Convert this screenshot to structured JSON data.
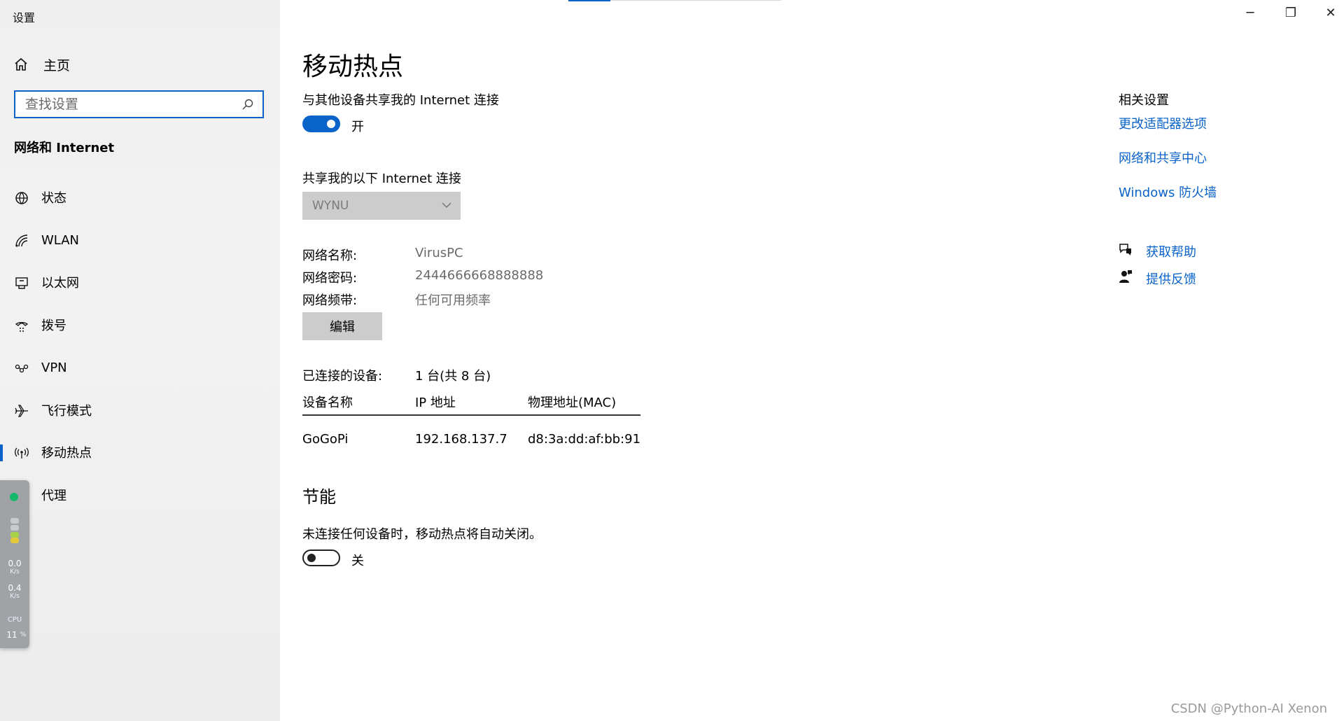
{
  "window": {
    "title": "设置",
    "controls": [
      "─",
      "❐",
      "✕"
    ]
  },
  "sidebar": {
    "home_label": "主页",
    "search_placeholder": "查找设置",
    "section_title": "网络和 Internet",
    "items": [
      {
        "label": "状态",
        "icon": "globe-status-icon"
      },
      {
        "label": "WLAN",
        "icon": "wifi-icon"
      },
      {
        "label": "以太网",
        "icon": "ethernet-icon"
      },
      {
        "label": "拨号",
        "icon": "dialup-icon"
      },
      {
        "label": "VPN",
        "icon": "vpn-icon"
      },
      {
        "label": "飞行模式",
        "icon": "airplane-icon"
      },
      {
        "label": "移动热点",
        "icon": "hotspot-icon",
        "active": true
      },
      {
        "label": "代理",
        "icon": "globe-proxy-icon"
      }
    ]
  },
  "net_monitor": {
    "up_value": "0.0",
    "up_unit": "K/s",
    "down_value": "0.4",
    "down_unit": "K/s",
    "cpu_label": "CPU",
    "cpu_value": "11",
    "cpu_unit": "%"
  },
  "main": {
    "title": "移动热点",
    "share_label": "与其他设备共享我的 Internet 连接",
    "share_toggle": {
      "on": true,
      "state_text": "开"
    },
    "share_from_label": "共享我的以下 Internet 连接",
    "share_from_value": "WYNU",
    "props": [
      {
        "key": "网络名称:",
        "value": "VirusPC"
      },
      {
        "key": "网络密码:",
        "value": "2444666668888888"
      },
      {
        "key": "网络频带:",
        "value": "任何可用频率"
      }
    ],
    "edit_button": "编辑",
    "connected_label": "已连接的设备:",
    "connected_value": "1 台(共 8 台)",
    "table": {
      "headers": [
        "设备名称",
        "IP 地址",
        "物理地址(MAC)"
      ],
      "rows": [
        [
          "GoGoPi",
          "192.168.137.7",
          "d8:3a:dd:af:bb:91"
        ]
      ]
    },
    "power_title": "节能",
    "power_desc": "未连接任何设备时，移动热点将自动关闭。",
    "power_toggle": {
      "on": false,
      "state_text": "关"
    }
  },
  "related": {
    "title": "相关设置",
    "links": [
      "更改适配器选项",
      "网络和共享中心",
      "Windows 防火墙"
    ],
    "help": [
      {
        "label": "获取帮助",
        "icon": "help-chat-icon"
      },
      {
        "label": "提供反馈",
        "icon": "feedback-icon"
      }
    ]
  },
  "watermark": "CSDN @Python-AI Xenon",
  "colors": {
    "accent": "#0a63c9",
    "sidebar_bg": "#f0f0f1",
    "disabled_bg": "#cccccc"
  }
}
